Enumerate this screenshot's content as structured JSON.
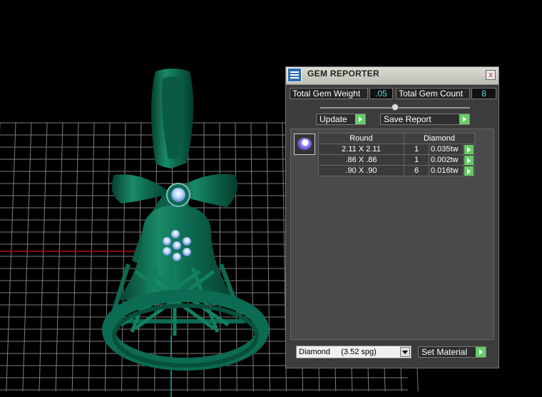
{
  "panel": {
    "title": "GEM REPORTER",
    "close_glyph": "x",
    "total_gem_weight": {
      "label": "Total Gem Weight",
      "value": ".05"
    },
    "total_gem_count": {
      "label": "Total Gem Count",
      "value": "8"
    },
    "update_button": "Update",
    "save_report_button": "Save Report",
    "table": {
      "header": {
        "shape": "Round",
        "material": "Diamond"
      },
      "rows": [
        {
          "size": "2.11 X 2.11",
          "count": "1",
          "weight": "0.035tw"
        },
        {
          "size": ".86 X .86",
          "count": "1",
          "weight": "0.002tw"
        },
        {
          "size": ".90 X .90",
          "count": "6",
          "weight": "0.016tw"
        }
      ]
    },
    "material_select": "Diamond     (3.52 spg)",
    "set_material_button": "Set Material",
    "slider_level": 0.5
  },
  "colors": {
    "model_green": "#0c6b52",
    "accent_green": "#66cc66",
    "value_cyan": "#5fd7d7",
    "panel_bg": "#3c3c3c"
  }
}
